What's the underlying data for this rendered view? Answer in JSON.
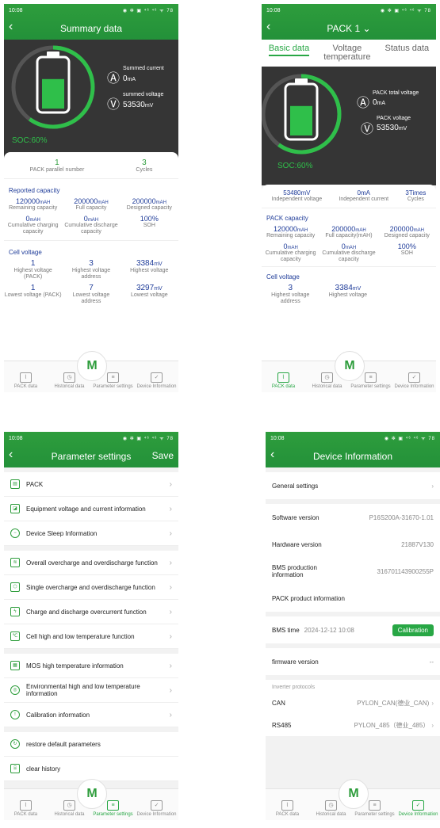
{
  "status": {
    "time": "10:08",
    "icons": "◉ ✻ ▣ ⁴⁶ ⁴⁶ ᯤ 78"
  },
  "summary": {
    "title": "Summary data",
    "soc": "SOC:60%",
    "soc_fraction": 0.6,
    "summed_current_label": "Summed current",
    "summed_current_value": "0",
    "summed_current_unit": "mA",
    "summed_voltage_label": "summed voltage",
    "summed_voltage_value": "53530",
    "summed_voltage_unit": "mV",
    "pack_parallel_value": "1",
    "pack_parallel_label": "PACK parallel number",
    "cycles_value": "3",
    "cycles_label": "Cycles",
    "reported_capacity_title": "Reported capacity",
    "capacity": [
      {
        "value": "120000",
        "unit": "mAH",
        "label": "Remaining capacity"
      },
      {
        "value": "200000",
        "unit": "mAH",
        "label": "Full capacity"
      },
      {
        "value": "200000",
        "unit": "mAH",
        "label": "Designed capacity"
      },
      {
        "value": "0",
        "unit": "mAH",
        "label": "Cumulative charging capacity"
      },
      {
        "value": "0",
        "unit": "mAH",
        "label": "Cumulative discharge capacity"
      },
      {
        "value": "100%",
        "unit": "",
        "label": "SOH"
      }
    ],
    "cell_voltage_title": "Cell voltage",
    "cells": [
      {
        "value": "1",
        "unit": "",
        "label": "Highest voltage (PACK)"
      },
      {
        "value": "3",
        "unit": "",
        "label": "Highest voltage address"
      },
      {
        "value": "3384",
        "unit": "mV",
        "label": "Highest voltage"
      },
      {
        "value": "1",
        "unit": "",
        "label": "Lowest voltage (PACK)"
      },
      {
        "value": "7",
        "unit": "",
        "label": "Lowest voltage address"
      },
      {
        "value": "3297",
        "unit": "mV",
        "label": "Lowest voltage"
      }
    ]
  },
  "pack": {
    "title": "PACK 1",
    "tabs": [
      "Basic data",
      "Voltage temperature",
      "Status data"
    ],
    "soc": "SOC:60%",
    "total_voltage_label": "PACK total voltage",
    "total_voltage_value": "0",
    "total_voltage_unit": "mA",
    "pack_voltage_label": "PACK voltage",
    "pack_voltage_value": "53530",
    "pack_voltage_unit": "mV",
    "ind_voltage_value": "53480mV",
    "ind_voltage_label": "Independent voltage",
    "ind_current_value": "0mA",
    "ind_current_label": "Independent current",
    "cycles_value": "3Times",
    "cycles_label": "Cycles",
    "capacity_title": "PACK capacity",
    "capacity": [
      {
        "value": "120000",
        "unit": "mAH",
        "label": "Remaining capacity"
      },
      {
        "value": "200000",
        "unit": "mAH",
        "label": "Full capacity(mAH)"
      },
      {
        "value": "200000",
        "unit": "mAH",
        "label": "Designed capacity"
      },
      {
        "value": "0",
        "unit": "mAH",
        "label": "Cumulative charging capacity"
      },
      {
        "value": "0",
        "unit": "mAH",
        "label": "Cumulative discharge capacity"
      },
      {
        "value": "100%",
        "unit": "",
        "label": "SOH"
      }
    ],
    "cell_voltage_title": "Cell voltage",
    "cells": [
      {
        "value": "3",
        "unit": "",
        "label": "Highest voltage address"
      },
      {
        "value": "3384",
        "unit": "mV",
        "label": "Highest voltage"
      }
    ]
  },
  "params": {
    "title": "Parameter settings",
    "save": "Save",
    "groups": [
      [
        "PACK",
        "Equipment voltage and current information",
        "Device Sleep Information"
      ],
      [
        "Overall overcharge and overdischarge function",
        "Single overcharge and overdischarge function",
        "Charge and discharge overcurrent function",
        "Cell high and low temperature function"
      ],
      [
        "MOS high temperature information",
        "Environmental high and low temperature information",
        "Calibration information"
      ],
      [
        "restore default parameters",
        "clear history"
      ]
    ]
  },
  "device": {
    "title": "Device Information",
    "general_settings": "General settings",
    "software_label": "Software version",
    "software_value": "P16S200A-31670-1.01",
    "hardware_label": "Hardware version",
    "hardware_value": "21887V130",
    "bms_prod_label": "BMS production information",
    "bms_prod_value": "316701143900255P",
    "pack_product_label": "PACK product information",
    "bms_time_label": "BMS time",
    "bms_time_value": "2024-12-12 10:08",
    "calibration": "Calibration",
    "firmware_label": "firmware version",
    "firmware_value": "--",
    "inverter_title": "Inverter protocols",
    "can_label": "CAN",
    "can_value": "PYLON_CAN(德业_CAN)",
    "rs485_label": "RS485",
    "rs485_value": "PYLON_485（德业_485）"
  },
  "tabs": {
    "pack_data": "PACK data",
    "historical": "Historical data",
    "parameter": "Parameter settings",
    "device": "Device Information"
  }
}
